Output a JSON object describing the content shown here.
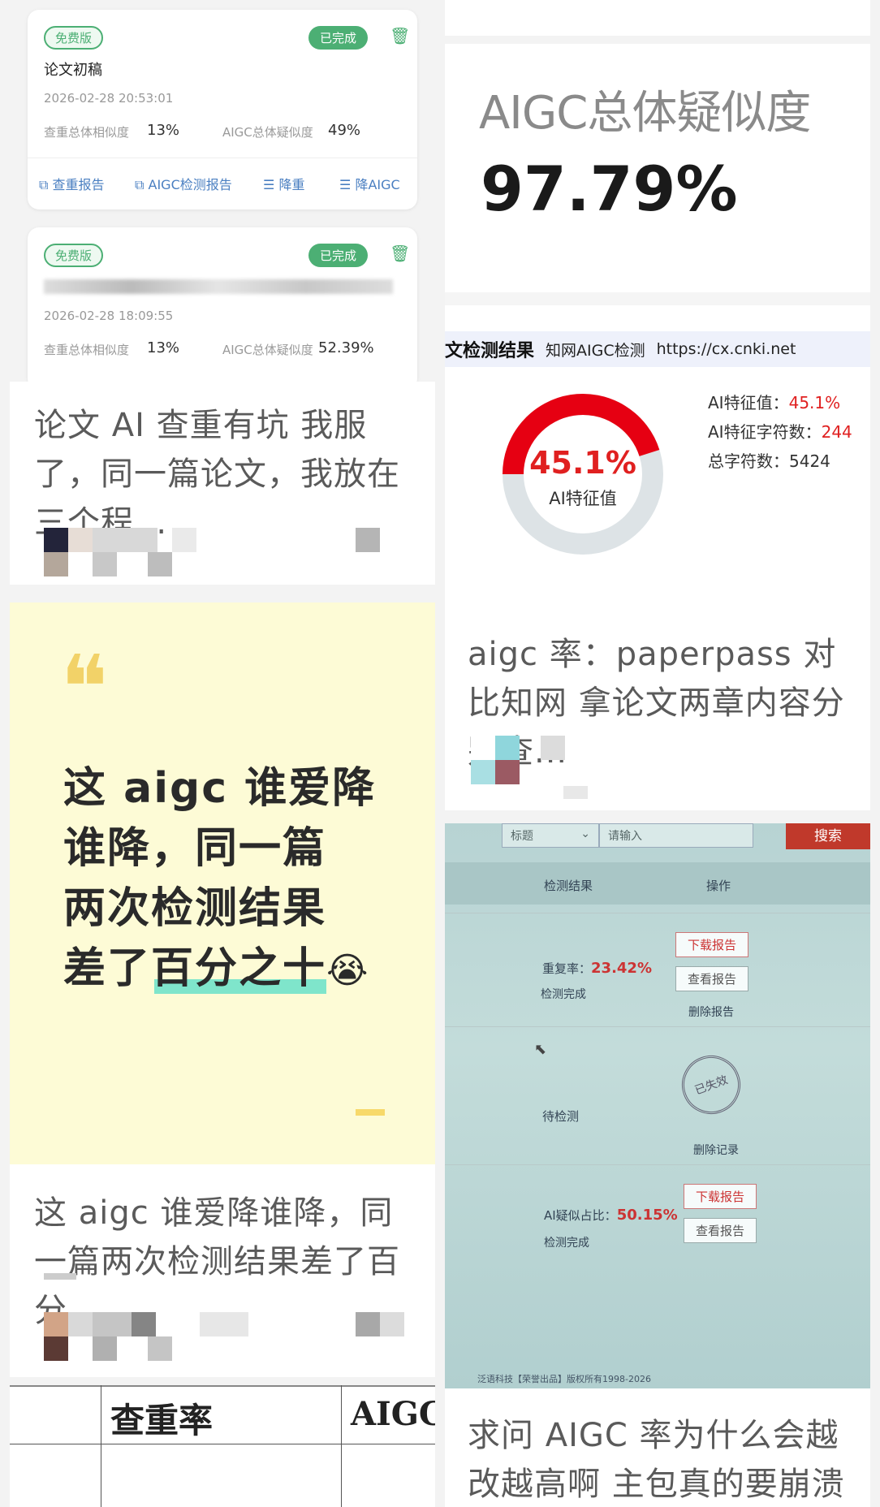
{
  "left": {
    "screenshot_card": {
      "records": [
        {
          "badge_free": "免费版",
          "badge_done": "已完成",
          "title": "论文初稿",
          "datetime": "2026-02-28 20:53:01",
          "dup_label": "查重总体相似度",
          "dup_value": "13%",
          "aigc_label": "AIGC总体疑似度",
          "aigc_value": "49%"
        },
        {
          "badge_free": "免费版",
          "badge_done": "已完成",
          "title": "",
          "datetime": "2026-02-28 18:09:55",
          "dup_label": "查重总体相似度",
          "dup_value": "13%",
          "aigc_label": "AIGC总体疑似度",
          "aigc_value": "52.39%"
        }
      ],
      "actions": [
        "查重报告",
        "AIGC检测报告",
        "降重",
        "降AIGC"
      ]
    },
    "post1_title": "论文 AI 查重有坑 我服了，同一篇论文，我放在三个程...",
    "quote_card": {
      "line1": "这 aigc 谁爱降",
      "line2": "谁降，同一篇",
      "line3": "两次检测结果",
      "line4": "差了百分之十"
    },
    "post2_title": "这 aigc 谁爱降谁降，同一篇两次检测结果差了百分...",
    "table_card": {
      "col1": "查重率",
      "col2": "AIGC"
    }
  },
  "right": {
    "aigc_card": {
      "label": "AIGC总体疑似度",
      "value": "97.79%"
    },
    "cnki_card": {
      "header": "文检测结果",
      "source": "知网AIGC检测",
      "url": "https://cx.cnki.net",
      "donut_value": "45.1%",
      "donut_label": "AI特征值",
      "donut_fraction": 0.451,
      "stat1_label": "AI特征值：",
      "stat1_value": "45.1%",
      "stat2_label": "AI特征字符数：",
      "stat2_value": "244",
      "stat3_label": "总字符数：",
      "stat3_value": "5424"
    },
    "post3_title": "aigc 率：paperpass 对比知网 拿论文两章内容分别查...",
    "photo_card": {
      "filter_field": "标题",
      "search_placeholder": "请输入",
      "search_button": "搜索",
      "col_result": "检测结果",
      "col_action": "操作",
      "row1_label": "重复率：",
      "row1_value": "23.42%",
      "row1_status": "检测完成",
      "row1_btn_download": "下载报告",
      "row1_btn_view": "查看报告",
      "row1_btn_delete": "删除报告",
      "row2_status": "待检测",
      "row2_stamp": "已失效",
      "row2_btn_delete": "删除记录",
      "row3_label": "AI疑似占比：",
      "row3_value": "50.15%",
      "row3_status": "检测完成",
      "row3_btn_download": "下载报告",
      "row3_btn_view": "查看报告",
      "footer": "泛语科技【荣誉出品】版权所有1998-2026"
    },
    "post4_title": "求问 AIGC 率为什么会越改越高啊 主包真的要崩溃了..."
  },
  "colors": {
    "green": "#4caf74",
    "red": "#e02020",
    "quote_bg": "#fdfbd6",
    "highlight": "#5fe0c8"
  }
}
